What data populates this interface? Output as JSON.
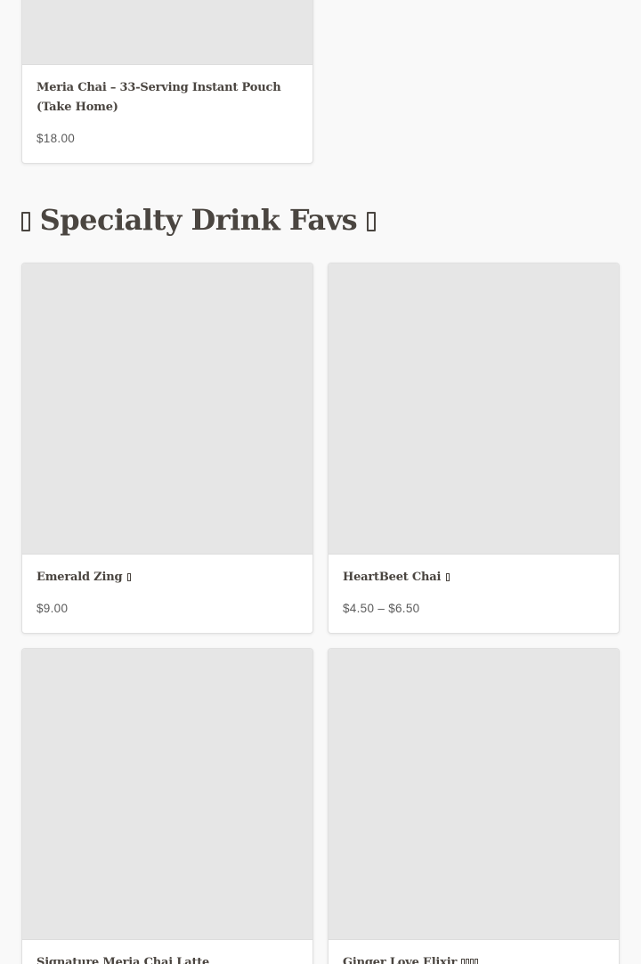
{
  "section": {
    "heading": "Specialty Drink Favs"
  },
  "top_product": {
    "title": "Meria Chai – 33-Serving Instant Pouch (Take Home)",
    "price": "$18.00"
  },
  "products": [
    {
      "title": "Emerald Zing",
      "price": "$9.00"
    },
    {
      "title": "HeartBeet Chai",
      "price": "$4.50 – $6.50"
    },
    {
      "title": "Signature Meria Chai Latte",
      "price": ""
    },
    {
      "title": "Ginger Love Elixir",
      "price": ""
    }
  ]
}
